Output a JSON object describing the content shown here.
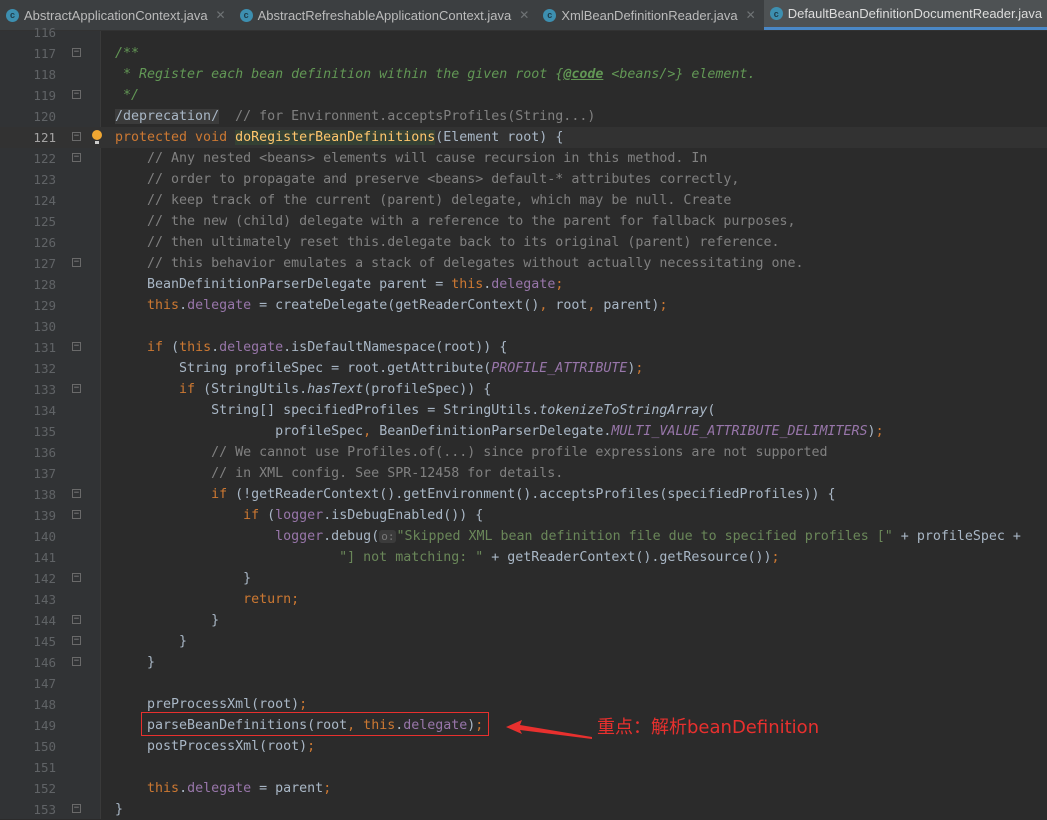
{
  "tabs": [
    {
      "label": "AbstractApplicationContext.java",
      "icon": "class-icon",
      "active": false
    },
    {
      "label": "AbstractRefreshableApplicationContext.java",
      "icon": "class-icon",
      "active": false
    },
    {
      "label": "XmlBeanDefinitionReader.java",
      "icon": "class-icon",
      "active": false
    },
    {
      "label": "DefaultBeanDefinitionDocumentReader.java",
      "icon": "class-icon",
      "active": true
    }
  ],
  "current_line": 121,
  "colors": {
    "keyword": "#cc7832",
    "comment": "#808080",
    "doc": "#629755",
    "string": "#6a8759",
    "field": "#9876aa",
    "method": "#ffc66d",
    "annotation": "#e8302e"
  },
  "lines": [
    {
      "n": "116",
      "t": []
    },
    {
      "n": "117",
      "fold": true,
      "t": [
        [
          "d",
          "/**"
        ]
      ]
    },
    {
      "n": "118",
      "t": [
        [
          "d",
          " * Register each bean definition within the given root {"
        ],
        [
          "dt",
          "@code"
        ],
        [
          "d",
          " <beans/>} element."
        ]
      ]
    },
    {
      "n": "119",
      "fold": true,
      "t": [
        [
          "d",
          " */"
        ]
      ]
    },
    {
      "n": "120",
      "t": [
        [
          "dep",
          "/deprecation/"
        ],
        [
          "c",
          "  // for Environment.acceptsProfiles(String...)"
        ]
      ]
    },
    {
      "n": "121",
      "fold": true,
      "bulb": true,
      "t": [
        [
          "k",
          "protected void "
        ],
        [
          "m",
          "doRegisterBeanDefinitions"
        ],
        [
          "p",
          "(Element root) {"
        ]
      ]
    },
    {
      "n": "122",
      "fold": true,
      "t": [
        [
          "p",
          "    "
        ],
        [
          "c",
          "// Any nested <beans> elements will cause recursion in this method. In"
        ]
      ]
    },
    {
      "n": "123",
      "t": [
        [
          "p",
          "    "
        ],
        [
          "c",
          "// order to propagate and preserve <beans> default-* attributes correctly,"
        ]
      ]
    },
    {
      "n": "124",
      "t": [
        [
          "p",
          "    "
        ],
        [
          "c",
          "// keep track of the current (parent) delegate, which may be null. Create"
        ]
      ]
    },
    {
      "n": "125",
      "t": [
        [
          "p",
          "    "
        ],
        [
          "c",
          "// the new (child) delegate with a reference to the parent for fallback purposes,"
        ]
      ]
    },
    {
      "n": "126",
      "t": [
        [
          "p",
          "    "
        ],
        [
          "c",
          "// then ultimately reset this.delegate back to its original (parent) reference."
        ]
      ]
    },
    {
      "n": "127",
      "fold": true,
      "t": [
        [
          "p",
          "    "
        ],
        [
          "c",
          "// this behavior emulates a stack of delegates without actually necessitating one."
        ]
      ]
    },
    {
      "n": "128",
      "t": [
        [
          "p",
          "    BeanDefinitionParserDelegate parent = "
        ],
        [
          "k",
          "this"
        ],
        [
          "p",
          "."
        ],
        [
          "f",
          "delegate"
        ],
        [
          "k",
          ";"
        ]
      ]
    },
    {
      "n": "129",
      "t": [
        [
          "p",
          "    "
        ],
        [
          "k",
          "this"
        ],
        [
          "p",
          "."
        ],
        [
          "f",
          "delegate"
        ],
        [
          "p",
          " = createDelegate(getReaderContext()"
        ],
        [
          "k",
          ", "
        ],
        [
          "p",
          "root"
        ],
        [
          "k",
          ", "
        ],
        [
          "p",
          "parent)"
        ],
        [
          "k",
          ";"
        ]
      ]
    },
    {
      "n": "130",
      "t": []
    },
    {
      "n": "131",
      "fold": true,
      "t": [
        [
          "p",
          "    "
        ],
        [
          "k",
          "if "
        ],
        [
          "p",
          "("
        ],
        [
          "k",
          "this"
        ],
        [
          "p",
          "."
        ],
        [
          "f",
          "delegate"
        ],
        [
          "p",
          ".isDefaultNamespace(root)) {"
        ]
      ]
    },
    {
      "n": "132",
      "t": [
        [
          "p",
          "        String profileSpec = root.getAttribute("
        ],
        [
          "ic",
          "PROFILE_ATTRIBUTE"
        ],
        [
          "p",
          ")"
        ],
        [
          "k",
          ";"
        ]
      ]
    },
    {
      "n": "133",
      "fold": true,
      "t": [
        [
          "p",
          "        "
        ],
        [
          "k",
          "if "
        ],
        [
          "p",
          "(StringUtils."
        ],
        [
          "i",
          "hasText"
        ],
        [
          "p",
          "(profileSpec)) {"
        ]
      ]
    },
    {
      "n": "134",
      "t": [
        [
          "p",
          "            String[] specifiedProfiles = StringUtils."
        ],
        [
          "i",
          "tokenizeToStringArray"
        ],
        [
          "p",
          "("
        ]
      ]
    },
    {
      "n": "135",
      "t": [
        [
          "p",
          "                    profileSpec"
        ],
        [
          "k",
          ", "
        ],
        [
          "p",
          "BeanDefinitionParserDelegate."
        ],
        [
          "ic",
          "MULTI_VALUE_ATTRIBUTE_DELIMITERS"
        ],
        [
          "p",
          ")"
        ],
        [
          "k",
          ";"
        ]
      ]
    },
    {
      "n": "136",
      "t": [
        [
          "p",
          "            "
        ],
        [
          "c",
          "// We cannot use Profiles.of(...) since profile expressions are not supported"
        ]
      ]
    },
    {
      "n": "137",
      "t": [
        [
          "p",
          "            "
        ],
        [
          "c",
          "// in XML config. See SPR-12458 for details."
        ]
      ]
    },
    {
      "n": "138",
      "fold": true,
      "t": [
        [
          "p",
          "            "
        ],
        [
          "k",
          "if "
        ],
        [
          "p",
          "(!getReaderContext().getEnvironment().acceptsProfiles(specifiedProfiles)) {"
        ]
      ]
    },
    {
      "n": "139",
      "fold": true,
      "t": [
        [
          "p",
          "                "
        ],
        [
          "k",
          "if "
        ],
        [
          "p",
          "("
        ],
        [
          "f",
          "logger"
        ],
        [
          "p",
          ".isDebugEnabled()) {"
        ]
      ]
    },
    {
      "n": "140",
      "t": [
        [
          "p",
          "                    "
        ],
        [
          "f",
          "logger"
        ],
        [
          "p",
          ".debug("
        ],
        [
          "h",
          "o:"
        ],
        [
          "s",
          "\"Skipped XML bean definition file due to specified profiles [\""
        ],
        [
          "p",
          " + profileSpec +"
        ]
      ]
    },
    {
      "n": "141",
      "t": [
        [
          "p",
          "                            "
        ],
        [
          "s",
          "\"] not matching: \""
        ],
        [
          "p",
          " + getReaderContext().getResource())"
        ],
        [
          "k",
          ";"
        ]
      ]
    },
    {
      "n": "142",
      "fold": true,
      "t": [
        [
          "p",
          "                }"
        ]
      ]
    },
    {
      "n": "143",
      "t": [
        [
          "p",
          "                "
        ],
        [
          "k",
          "return;"
        ]
      ]
    },
    {
      "n": "144",
      "fold": true,
      "t": [
        [
          "p",
          "            }"
        ]
      ]
    },
    {
      "n": "145",
      "fold": true,
      "t": [
        [
          "p",
          "        }"
        ]
      ]
    },
    {
      "n": "146",
      "fold": true,
      "t": [
        [
          "p",
          "    }"
        ]
      ]
    },
    {
      "n": "147",
      "t": []
    },
    {
      "n": "148",
      "t": [
        [
          "p",
          "    preProcessXml(root)"
        ],
        [
          "k",
          ";"
        ]
      ]
    },
    {
      "n": "149",
      "t": [
        [
          "p",
          "    parseBeanDefinitions(root"
        ],
        [
          "k",
          ", this"
        ],
        [
          "p",
          "."
        ],
        [
          "f",
          "delegate"
        ],
        [
          "p",
          ")"
        ],
        [
          "k",
          ";"
        ]
      ]
    },
    {
      "n": "150",
      "t": [
        [
          "p",
          "    postProcessXml(root)"
        ],
        [
          "k",
          ";"
        ]
      ]
    },
    {
      "n": "151",
      "t": []
    },
    {
      "n": "152",
      "t": [
        [
          "p",
          "    "
        ],
        [
          "k",
          "this"
        ],
        [
          "p",
          "."
        ],
        [
          "f",
          "delegate"
        ],
        [
          "p",
          " = parent"
        ],
        [
          "k",
          ";"
        ]
      ]
    },
    {
      "n": "153",
      "fold": true,
      "t": [
        [
          "p",
          "}"
        ]
      ]
    }
  ],
  "annotation": {
    "text": "重点：解析beanDefinition"
  }
}
